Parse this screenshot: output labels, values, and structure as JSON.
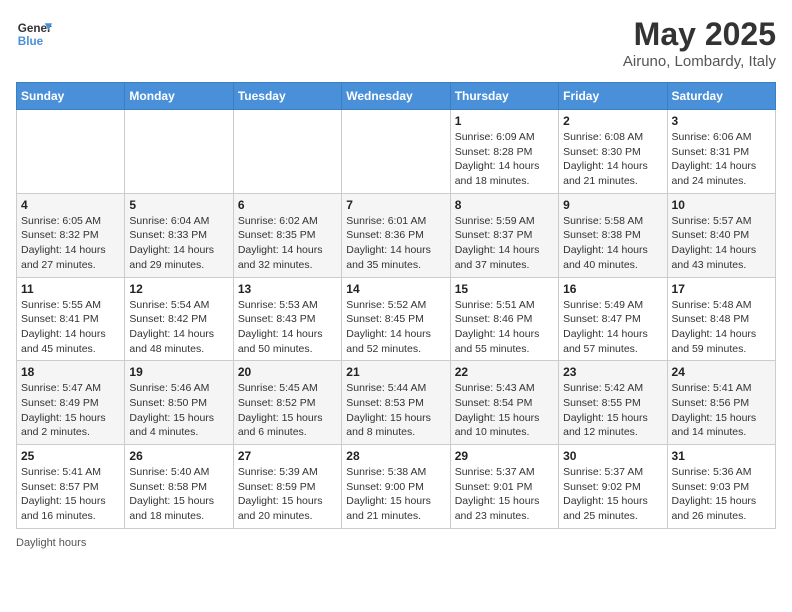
{
  "header": {
    "logo_line1": "General",
    "logo_line2": "Blue",
    "title": "May 2025",
    "subtitle": "Airuno, Lombardy, Italy"
  },
  "days_of_week": [
    "Sunday",
    "Monday",
    "Tuesday",
    "Wednesday",
    "Thursday",
    "Friday",
    "Saturday"
  ],
  "weeks": [
    [
      {
        "day": "",
        "info": ""
      },
      {
        "day": "",
        "info": ""
      },
      {
        "day": "",
        "info": ""
      },
      {
        "day": "",
        "info": ""
      },
      {
        "day": "1",
        "info": "Sunrise: 6:09 AM\nSunset: 8:28 PM\nDaylight: 14 hours and 18 minutes."
      },
      {
        "day": "2",
        "info": "Sunrise: 6:08 AM\nSunset: 8:30 PM\nDaylight: 14 hours and 21 minutes."
      },
      {
        "day": "3",
        "info": "Sunrise: 6:06 AM\nSunset: 8:31 PM\nDaylight: 14 hours and 24 minutes."
      }
    ],
    [
      {
        "day": "4",
        "info": "Sunrise: 6:05 AM\nSunset: 8:32 PM\nDaylight: 14 hours and 27 minutes."
      },
      {
        "day": "5",
        "info": "Sunrise: 6:04 AM\nSunset: 8:33 PM\nDaylight: 14 hours and 29 minutes."
      },
      {
        "day": "6",
        "info": "Sunrise: 6:02 AM\nSunset: 8:35 PM\nDaylight: 14 hours and 32 minutes."
      },
      {
        "day": "7",
        "info": "Sunrise: 6:01 AM\nSunset: 8:36 PM\nDaylight: 14 hours and 35 minutes."
      },
      {
        "day": "8",
        "info": "Sunrise: 5:59 AM\nSunset: 8:37 PM\nDaylight: 14 hours and 37 minutes."
      },
      {
        "day": "9",
        "info": "Sunrise: 5:58 AM\nSunset: 8:38 PM\nDaylight: 14 hours and 40 minutes."
      },
      {
        "day": "10",
        "info": "Sunrise: 5:57 AM\nSunset: 8:40 PM\nDaylight: 14 hours and 43 minutes."
      }
    ],
    [
      {
        "day": "11",
        "info": "Sunrise: 5:55 AM\nSunset: 8:41 PM\nDaylight: 14 hours and 45 minutes."
      },
      {
        "day": "12",
        "info": "Sunrise: 5:54 AM\nSunset: 8:42 PM\nDaylight: 14 hours and 48 minutes."
      },
      {
        "day": "13",
        "info": "Sunrise: 5:53 AM\nSunset: 8:43 PM\nDaylight: 14 hours and 50 minutes."
      },
      {
        "day": "14",
        "info": "Sunrise: 5:52 AM\nSunset: 8:45 PM\nDaylight: 14 hours and 52 minutes."
      },
      {
        "day": "15",
        "info": "Sunrise: 5:51 AM\nSunset: 8:46 PM\nDaylight: 14 hours and 55 minutes."
      },
      {
        "day": "16",
        "info": "Sunrise: 5:49 AM\nSunset: 8:47 PM\nDaylight: 14 hours and 57 minutes."
      },
      {
        "day": "17",
        "info": "Sunrise: 5:48 AM\nSunset: 8:48 PM\nDaylight: 14 hours and 59 minutes."
      }
    ],
    [
      {
        "day": "18",
        "info": "Sunrise: 5:47 AM\nSunset: 8:49 PM\nDaylight: 15 hours and 2 minutes."
      },
      {
        "day": "19",
        "info": "Sunrise: 5:46 AM\nSunset: 8:50 PM\nDaylight: 15 hours and 4 minutes."
      },
      {
        "day": "20",
        "info": "Sunrise: 5:45 AM\nSunset: 8:52 PM\nDaylight: 15 hours and 6 minutes."
      },
      {
        "day": "21",
        "info": "Sunrise: 5:44 AM\nSunset: 8:53 PM\nDaylight: 15 hours and 8 minutes."
      },
      {
        "day": "22",
        "info": "Sunrise: 5:43 AM\nSunset: 8:54 PM\nDaylight: 15 hours and 10 minutes."
      },
      {
        "day": "23",
        "info": "Sunrise: 5:42 AM\nSunset: 8:55 PM\nDaylight: 15 hours and 12 minutes."
      },
      {
        "day": "24",
        "info": "Sunrise: 5:41 AM\nSunset: 8:56 PM\nDaylight: 15 hours and 14 minutes."
      }
    ],
    [
      {
        "day": "25",
        "info": "Sunrise: 5:41 AM\nSunset: 8:57 PM\nDaylight: 15 hours and 16 minutes."
      },
      {
        "day": "26",
        "info": "Sunrise: 5:40 AM\nSunset: 8:58 PM\nDaylight: 15 hours and 18 minutes."
      },
      {
        "day": "27",
        "info": "Sunrise: 5:39 AM\nSunset: 8:59 PM\nDaylight: 15 hours and 20 minutes."
      },
      {
        "day": "28",
        "info": "Sunrise: 5:38 AM\nSunset: 9:00 PM\nDaylight: 15 hours and 21 minutes."
      },
      {
        "day": "29",
        "info": "Sunrise: 5:37 AM\nSunset: 9:01 PM\nDaylight: 15 hours and 23 minutes."
      },
      {
        "day": "30",
        "info": "Sunrise: 5:37 AM\nSunset: 9:02 PM\nDaylight: 15 hours and 25 minutes."
      },
      {
        "day": "31",
        "info": "Sunrise: 5:36 AM\nSunset: 9:03 PM\nDaylight: 15 hours and 26 minutes."
      }
    ]
  ],
  "footer": "Daylight hours"
}
